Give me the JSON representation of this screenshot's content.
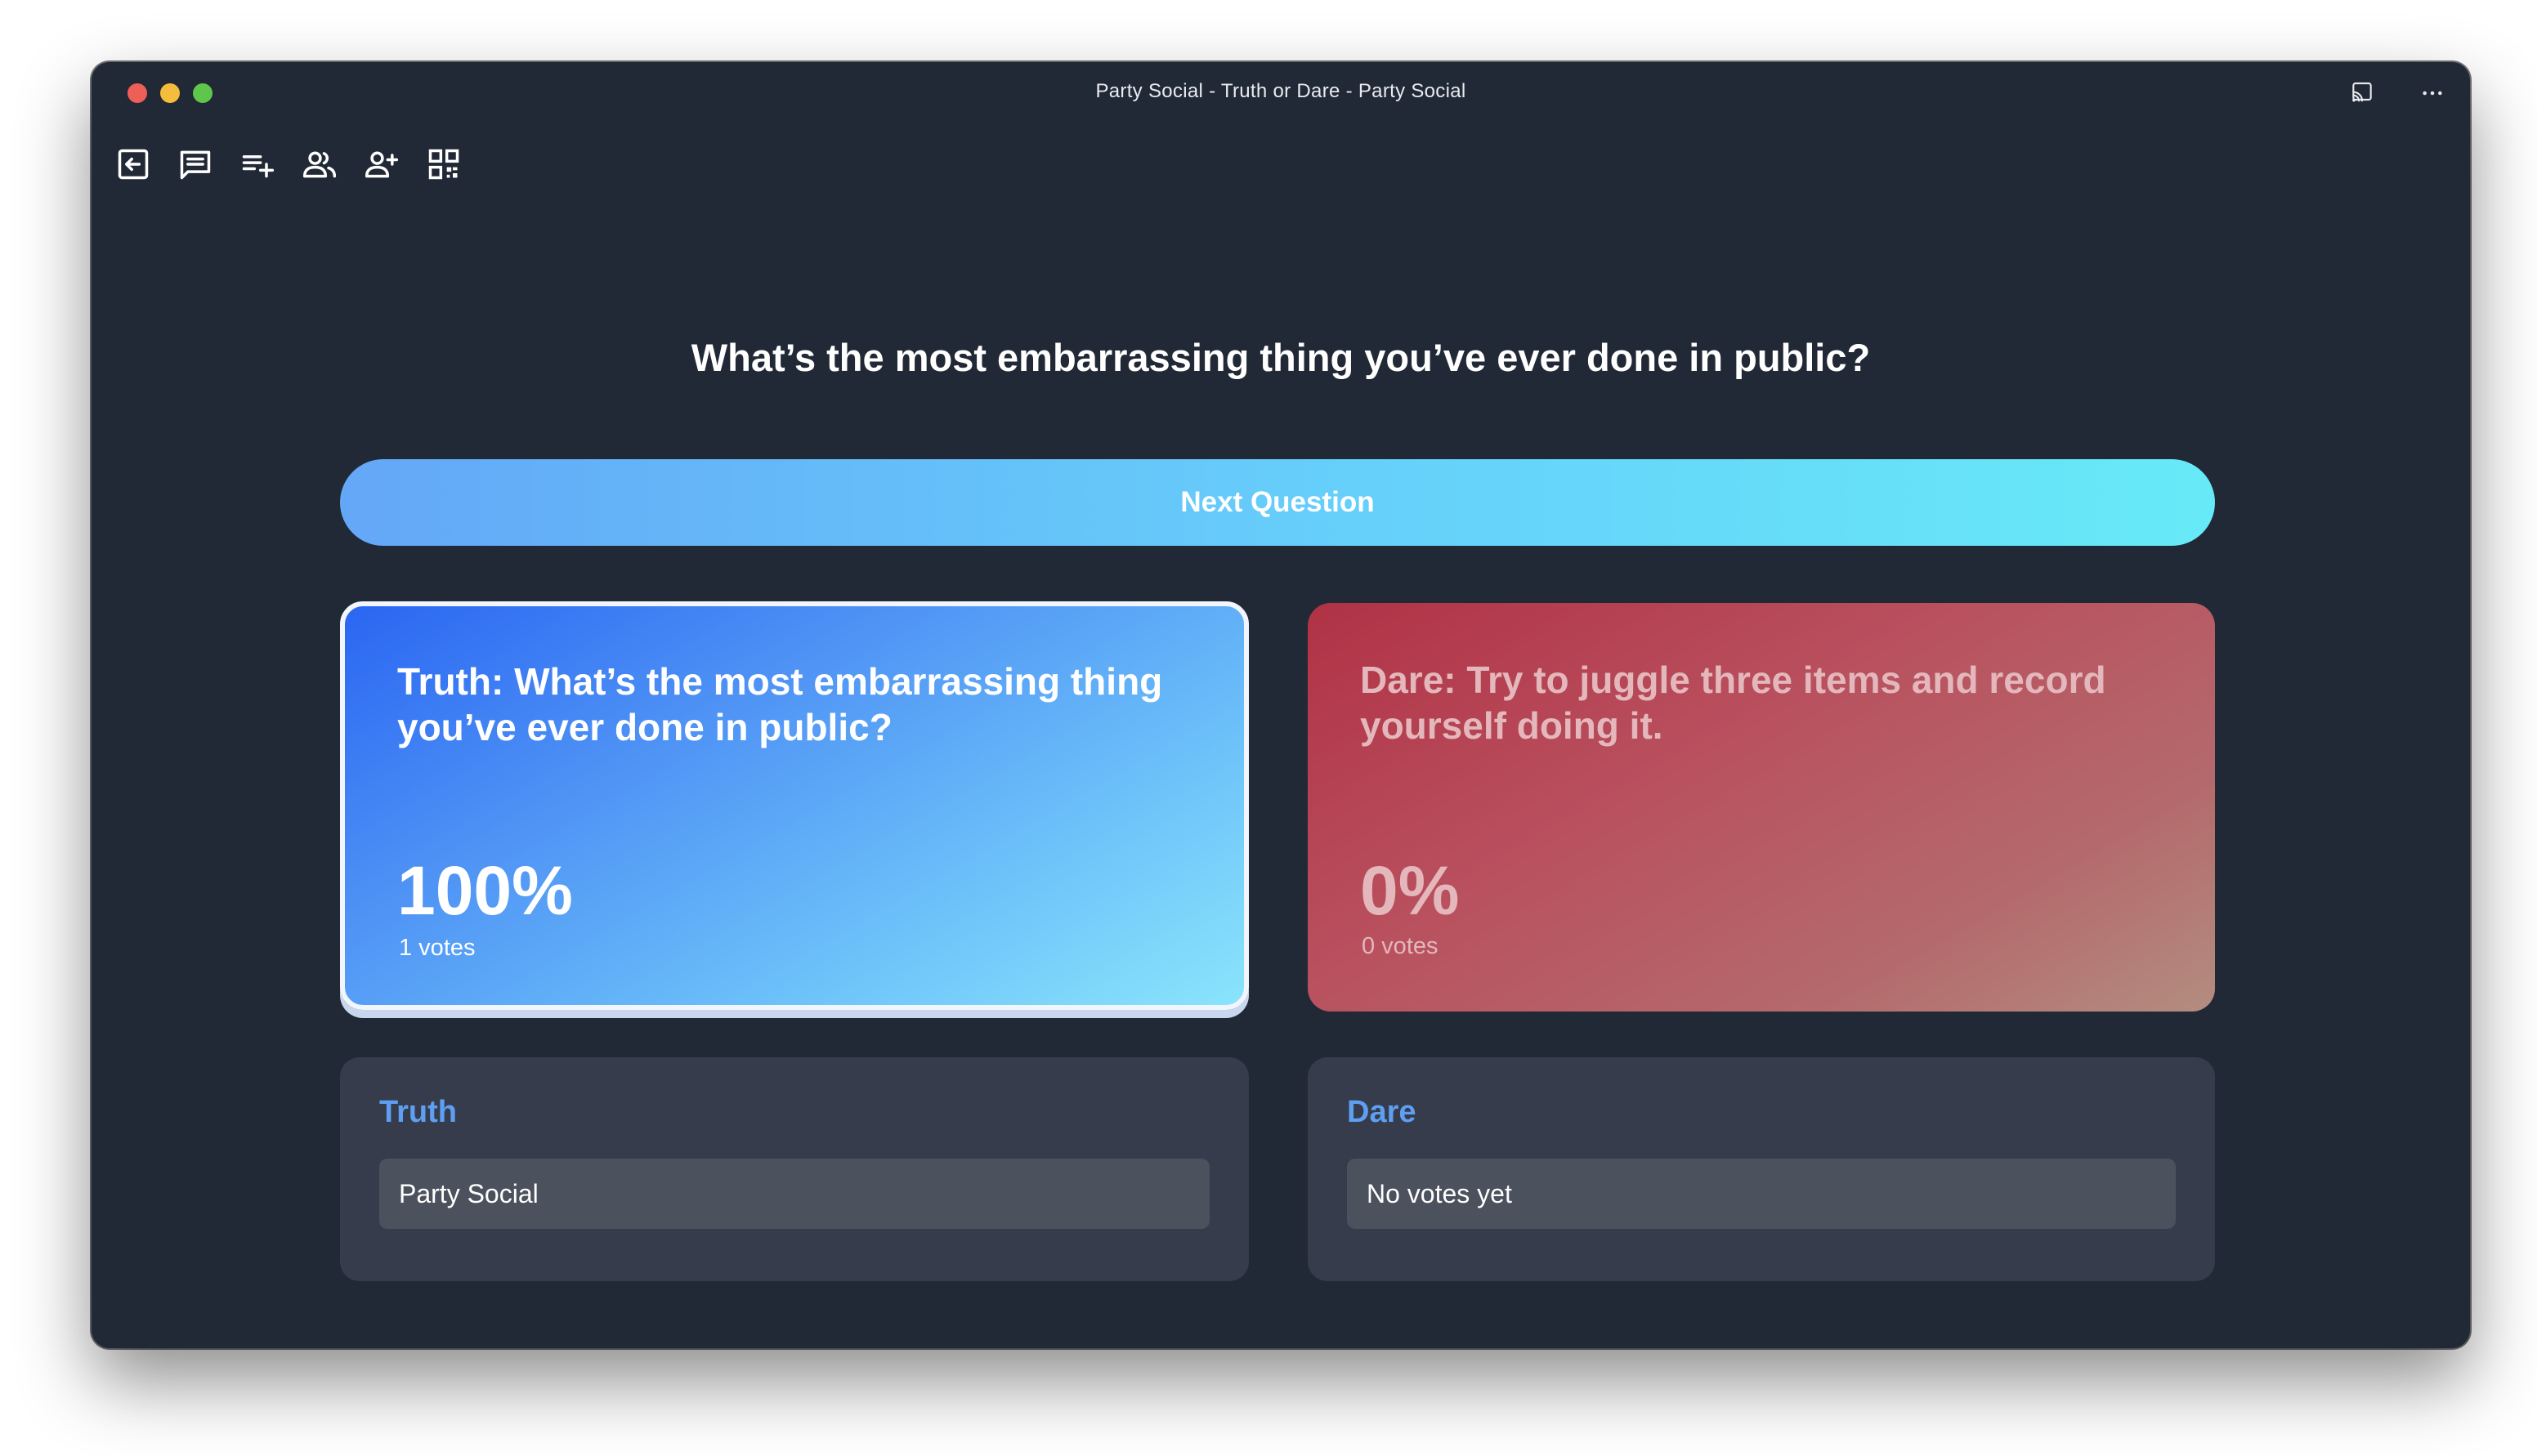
{
  "window": {
    "title": "Party Social - Truth or Dare - Party Social"
  },
  "toolbar": {
    "icons": [
      "exit-icon",
      "chat-icon",
      "add-to-list-icon",
      "people-icon",
      "add-person-icon",
      "qr-code-icon"
    ],
    "right_icons": [
      "cast-icon",
      "more-icon"
    ]
  },
  "main": {
    "question": "What’s the most embarrassing thing you’ve ever done in public?",
    "next_button_label": "Next Question"
  },
  "cards": {
    "truth": {
      "text": "Truth: What’s the most embarrassing thing you’ve ever done in public?",
      "percent": "100%",
      "votes": "1 votes",
      "selected": true
    },
    "dare": {
      "text": "Dare: Try to juggle three items and record yourself doing it.",
      "percent": "0%",
      "votes": "0 votes",
      "selected": false
    }
  },
  "panels": {
    "truth": {
      "title": "Truth",
      "value": "Party Social"
    },
    "dare": {
      "title": "Dare",
      "value": "No votes yet"
    }
  },
  "colors": {
    "window_bg": "#222936",
    "accent_blue": "#5e9ff2",
    "truth_gradient_start": "#2a66f2",
    "truth_gradient_end": "#8ae4fb",
    "dare_gradient_start": "#b03245",
    "dare_gradient_end": "#b38d80"
  }
}
